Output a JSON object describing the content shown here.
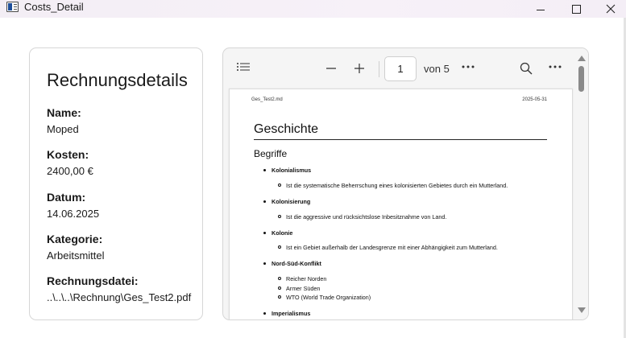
{
  "window": {
    "title": "Costs_Detail"
  },
  "details": {
    "heading": "Rechnungsdetails",
    "fields": [
      {
        "label": "Name:",
        "value": "Moped"
      },
      {
        "label": "Kosten:",
        "value": "2400,00 €"
      },
      {
        "label": "Datum:",
        "value": "14.06.2025"
      },
      {
        "label": "Kategorie:",
        "value": "Arbeitsmittel"
      },
      {
        "label": "Rechnungsdatei:",
        "value": "..\\..\\..\\Rechnung\\Ges_Test2.pdf"
      }
    ]
  },
  "viewer": {
    "page_number": "1",
    "page_total_label": "von 5",
    "icons": [
      "list-icon",
      "minus-icon",
      "plus-icon",
      "more-icon",
      "search-icon",
      "more-icon"
    ]
  },
  "document": {
    "filename": "Ges_Test2.md",
    "date": "2025-05-31",
    "heading": "Geschichte",
    "subheading": "Begriffe",
    "terms": [
      {
        "term": "Kolonialismus",
        "items": [
          "Ist die systematische Beherrschung eines kolonisierten Gebietes durch ein Mutterland."
        ]
      },
      {
        "term": "Kolonisierung",
        "items": [
          "Ist die aggressive und rücksichtslose Inbesitznahme von Land."
        ]
      },
      {
        "term": "Kolonie",
        "items": [
          "Ist ein Gebiet außerhalb der Landesgrenze mit einer Abhängigkeit zum Mutterland."
        ]
      },
      {
        "term": "Nord-Süd-Konflikt",
        "items": [
          "Reicher Norden",
          "Armer Süden",
          "WTO (World Trade Organization)"
        ]
      },
      {
        "term": "Imperialismus",
        "items": []
      }
    ]
  }
}
